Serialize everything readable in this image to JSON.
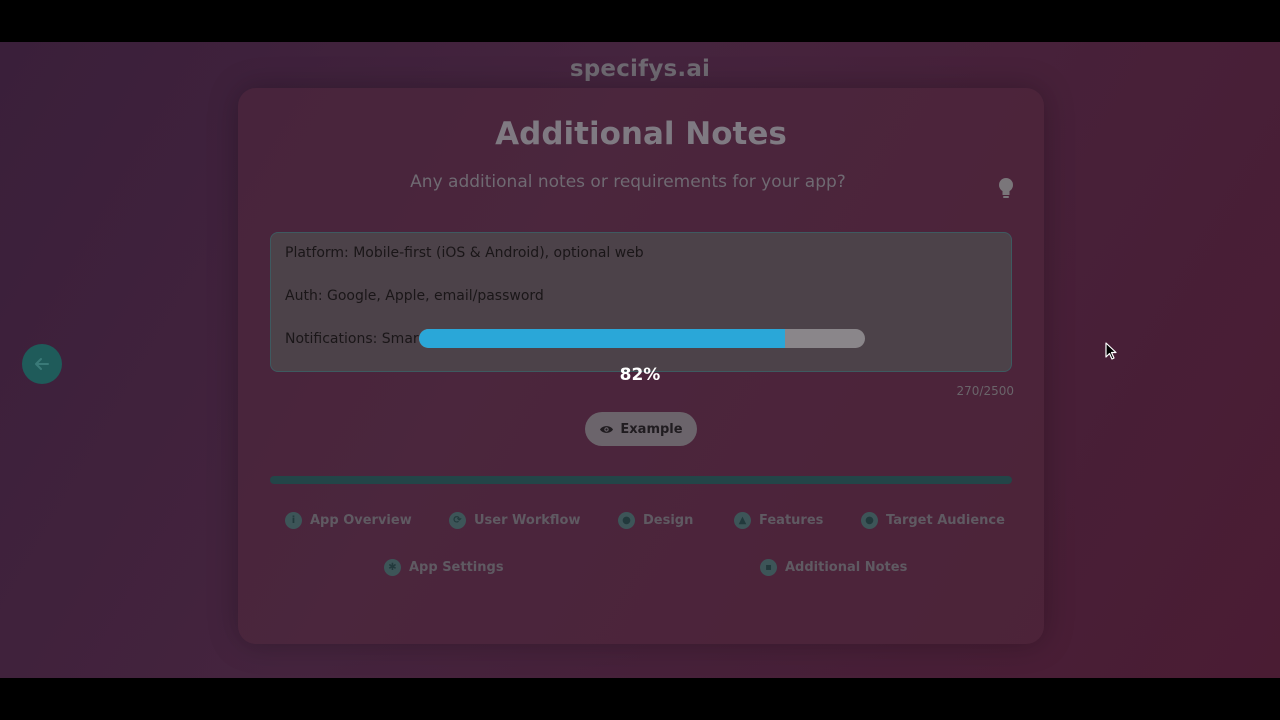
{
  "brand": "specifys.ai",
  "page": {
    "title": "Additional Notes",
    "subtitle": "Any additional notes or requirements for your app?"
  },
  "notes": {
    "line1": "Platform: Mobile-first (iOS & Android), optional web",
    "line2": "Auth: Google, Apple, email/password",
    "line3": "Notifications: Smar"
  },
  "char_count": "270/2500",
  "progress": {
    "value": 0.82,
    "label": "82%"
  },
  "example_button": {
    "label": "Example",
    "icon": "eye-icon"
  },
  "steps": [
    {
      "label": "App Overview",
      "icon": "info-icon"
    },
    {
      "label": "User Workflow",
      "icon": "sync-icon"
    },
    {
      "label": "Design",
      "icon": "palette-icon"
    },
    {
      "label": "Features",
      "icon": "flask-icon"
    },
    {
      "label": "Target Audience",
      "icon": "users-icon"
    },
    {
      "label": "App Settings",
      "icon": "gear-icon"
    },
    {
      "label": "Additional Notes",
      "icon": "file-icon"
    }
  ],
  "colors": {
    "accent": "#2aa7d8",
    "teal": "#1f5b5a"
  }
}
